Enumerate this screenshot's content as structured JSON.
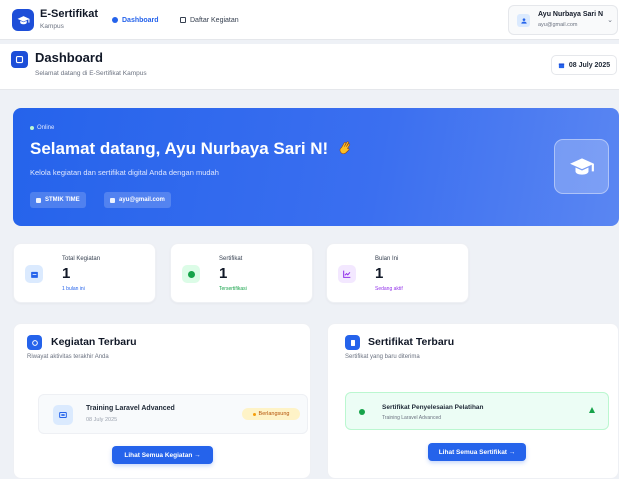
{
  "brand": {
    "title": "E-Sertifikat",
    "subtitle": "Kampus"
  },
  "nav": {
    "tabs": [
      {
        "label": "Dashboard",
        "active": true,
        "icon": "dashboard-dot-icon"
      },
      {
        "label": "Daftar Kegiatan",
        "active": false,
        "icon": "grid-icon"
      }
    ]
  },
  "user": {
    "name": "Ayu Nurbaya Sari N",
    "email": "ayu@gmail.com"
  },
  "header": {
    "title": "Dashboard",
    "subtitle": "Selamat datang di E-Sertifikat Kampus",
    "date": "08 July 2025"
  },
  "hero": {
    "status": "Online",
    "greeting": "Selamat datang, Ayu Nurbaya Sari N!",
    "subtitle": "Kelola kegiatan dan sertifikat digital Anda dengan mudah",
    "chips": [
      "STMIK TIME",
      "ayu@gmail.com"
    ]
  },
  "stats": [
    {
      "label": "Total Kegiatan",
      "value": "1",
      "note": "1 bulan ini",
      "color": "#2563eb",
      "bg": "#dbeafe",
      "icon": "calendar-icon"
    },
    {
      "label": "Sertifikat",
      "value": "1",
      "note": "Tersertifikasi",
      "color": "#16a34a",
      "bg": "#dcfce7",
      "icon": "certificate-dot-icon"
    },
    {
      "label": "Bulan Ini",
      "value": "1",
      "note": "Sedang aktif",
      "color": "#9333ea",
      "bg": "#f3e8ff",
      "icon": "chart-icon"
    }
  ],
  "recent_activities": {
    "title": "Kegiatan Terbaru",
    "subtitle": "Riwayat aktivitas terakhir Anda",
    "items": [
      {
        "title": "Training Laravel Advanced",
        "date": "08 July 2025",
        "status": "Berlangsung"
      }
    ],
    "button": "Lihat Semua Kegiatan →"
  },
  "recent_certificates": {
    "title": "Sertifikat Terbaru",
    "subtitle": "Sertifikat yang baru diterima",
    "items": [
      {
        "title": "Sertifikat Penyelesaian Pelatihan",
        "subtitle": "Training Laravel Advanced"
      }
    ],
    "button": "Lihat Semua Sertifikat →"
  },
  "colors": {
    "primary": "#2563eb",
    "success": "#16a34a",
    "warning": "#f59e0b",
    "background": "#eef1f6"
  }
}
